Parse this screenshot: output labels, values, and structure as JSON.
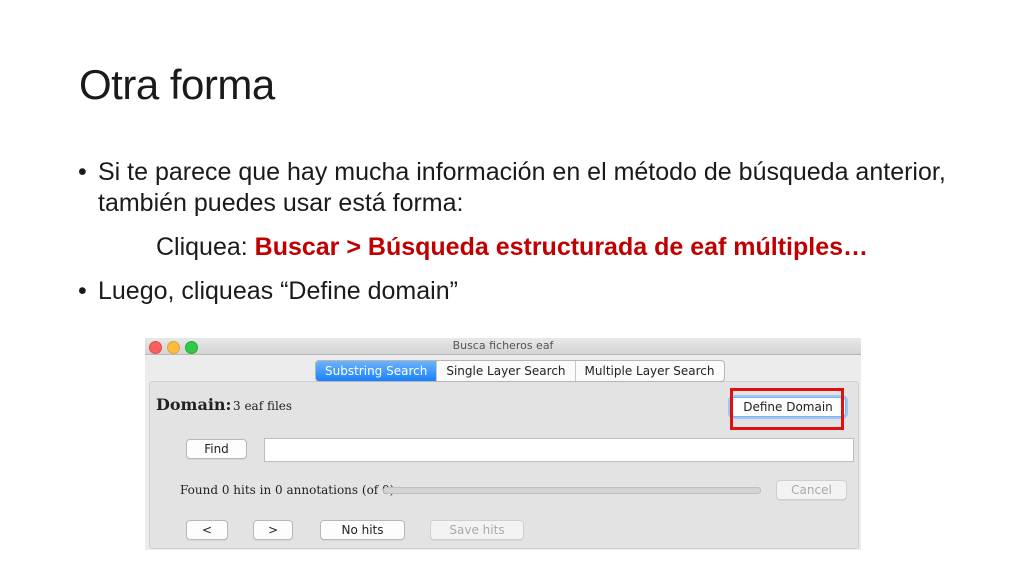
{
  "slide": {
    "title": "Otra forma",
    "bullet_symbol": "•",
    "bullet1": "Si te parece que hay mucha información en el método de búsqueda anterior, también puedes usar está forma:",
    "cliquea_prefix": "Cliquea: ",
    "cliquea_path": "Buscar > Búsqueda estructurada de eaf múltiples…",
    "bullet2": "Luego, cliqueas “Define domain”"
  },
  "window": {
    "title": "Busca ficheros eaf",
    "tabs": [
      "Substring Search",
      "Single Layer Search",
      "Multiple Layer Search"
    ],
    "active_tab": "Substring Search",
    "domain_label": "Domain:",
    "domain_value": "3 eaf files",
    "define_domain_label": "Define Domain",
    "find_label": "Find",
    "find_value": "",
    "status_text": "Found 0 hits in 0 annotations (of 0)",
    "progress": 0,
    "cancel_label": "Cancel",
    "prev_label": "<",
    "next_label": ">",
    "no_hits_label": "No hits",
    "save_hits_label": "Save hits"
  },
  "colors": {
    "highlight_red": "#c00000",
    "annotation_box": "#e01010",
    "active_tab_blue": "#1a82fb"
  }
}
